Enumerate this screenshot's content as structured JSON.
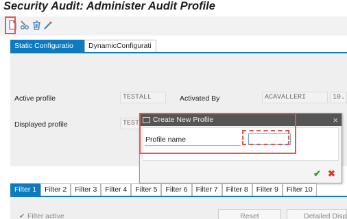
{
  "window": {
    "title": "Security Audit: Administer Audit Profile"
  },
  "toolbar": {
    "icons": [
      "new-document-icon",
      "pencil-glasses-icon",
      "trash-icon",
      "wand-icon"
    ]
  },
  "tabs": [
    {
      "label": "Static Configuratio",
      "active": true
    },
    {
      "label": "DynamicConfigurati",
      "active": false
    }
  ],
  "fields": {
    "active_profile_label": "Active profile",
    "active_profile_value": "TESTALL",
    "activated_by_label": "Activated By",
    "activated_by_value": "ACAVALLERI",
    "activated_extra_value": "10.",
    "displayed_profile_label": "Displayed profile",
    "displayed_profile_value": "TEST"
  },
  "dialog": {
    "title": "Create New Profile",
    "close_glyph": "×",
    "profile_name_label": "Profile name",
    "profile_name_value": "",
    "confirm_glyph": "✔",
    "cancel_glyph": "✖"
  },
  "filter_tabs": [
    {
      "label": "Filter 1",
      "active": true
    },
    {
      "label": "Filter 2",
      "active": false
    },
    {
      "label": "Filter 3",
      "active": false
    },
    {
      "label": "Filter 4",
      "active": false
    },
    {
      "label": "Filter 5",
      "active": false
    },
    {
      "label": "Filter 6",
      "active": false
    },
    {
      "label": "Filter 7",
      "active": false
    },
    {
      "label": "Filter 8",
      "active": false
    },
    {
      "label": "Filter 9",
      "active": false
    },
    {
      "label": "Filter 10",
      "active": false
    }
  ],
  "filter_panel": {
    "filter_active_label": "Filter active",
    "filter_active_checked": true,
    "reset_label": "Reset",
    "detailed_label": "Detailed Disp"
  },
  "colors": {
    "accent": "#0d7bc1",
    "highlight": "#e2574a",
    "dialog_title_bg": "#555555",
    "confirm": "#3a9a2e",
    "cancel": "#d23b2b"
  }
}
